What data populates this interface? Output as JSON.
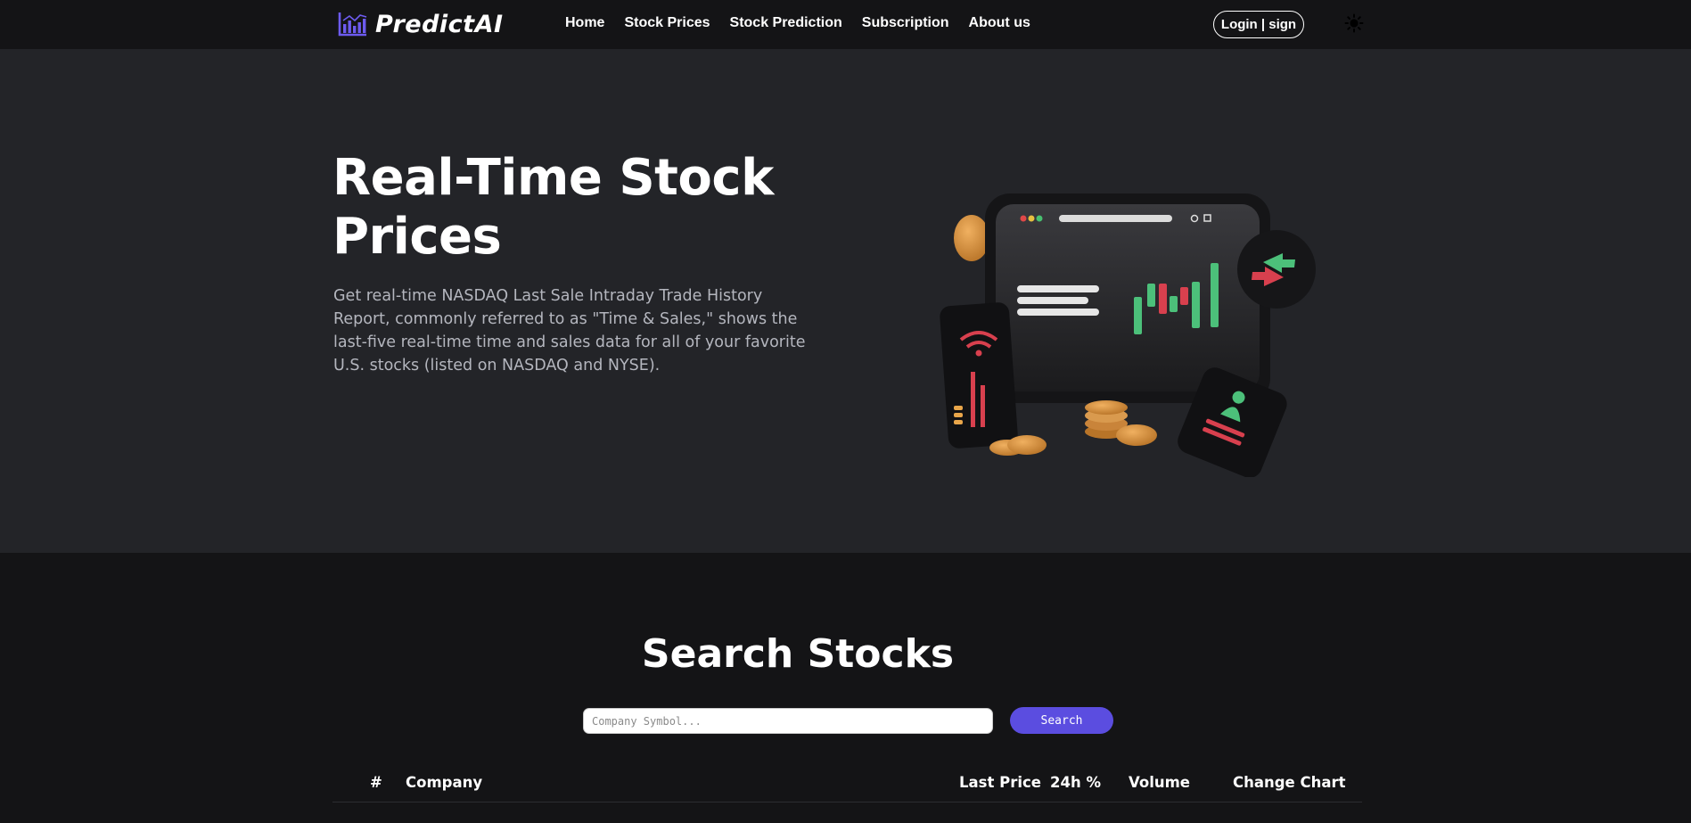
{
  "navbar": {
    "logo_text": "PredictAI",
    "logo_icon": "chart-logo-icon",
    "links": [
      "Home",
      "Stock Prices",
      "Stock Prediction",
      "Subscription",
      "About us"
    ],
    "login_label": "Login | sign",
    "theme_icon": "sun-icon"
  },
  "hero": {
    "title": "Real-Time Stock Prices",
    "description": "Get real-time NASDAQ Last Sale Intraday Trade History Report, commonly referred to as \"Time & Sales,\" shows the last-five real-time time and sales data for all of your favorite U.S. stocks (listed on NASDAQ and NYSE).",
    "illustration": "stock-dashboard-illustration"
  },
  "search": {
    "title": "Search Stocks",
    "placeholder": "Company Symbol...",
    "button_label": "Search"
  },
  "table": {
    "columns": [
      "#",
      "Company",
      "Last Price",
      "24h %",
      "Volume",
      "Change Chart"
    ]
  },
  "colors": {
    "accent": "#5b4de0",
    "hero_bg": "#232428",
    "page_bg": "#141416"
  }
}
